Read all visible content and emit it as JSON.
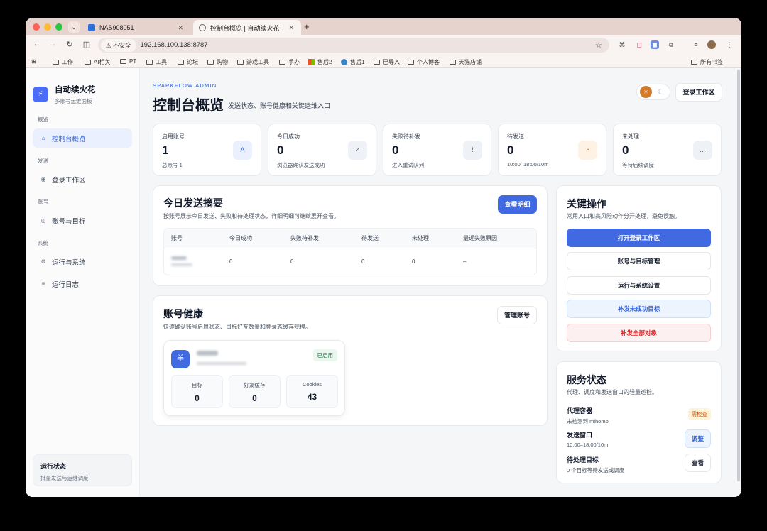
{
  "browser": {
    "tabs": [
      {
        "title": "NAS908051"
      },
      {
        "title": "控制台概览 | 自动续火花"
      }
    ],
    "insecure_label": "不安全",
    "url": "192.168.100.138:8787",
    "bookmarks": [
      "工作",
      "AI相关",
      "PT",
      "工具",
      "论坛",
      "购物",
      "游戏工具",
      "手办",
      "售后2",
      "售后1",
      "已导入",
      "个人博客",
      "天猫店铺"
    ],
    "all_bookmarks": "所有书签"
  },
  "sidebar": {
    "brand_title": "自动续火花",
    "brand_sub": "多账号运维面板",
    "sections": [
      {
        "label": "概览",
        "items": [
          {
            "label": "控制台概览",
            "icon": "home-icon"
          }
        ]
      },
      {
        "label": "发送",
        "items": [
          {
            "label": "登录工作区",
            "icon": "dot-icon"
          }
        ]
      },
      {
        "label": "账号",
        "items": [
          {
            "label": "账号与目标",
            "icon": "target-icon"
          }
        ]
      },
      {
        "label": "系统",
        "items": [
          {
            "label": "运行与系统",
            "icon": "gear-icon"
          },
          {
            "label": "运行日志",
            "icon": "list-icon"
          }
        ]
      }
    ],
    "status_title": "运行状态",
    "status_sub": "批量发送与运维调度"
  },
  "header": {
    "eyebrow": "SPARKFLOW ADMIN",
    "title": "控制台概览",
    "subtitle": "发送状态、账号健康和关键运维入口",
    "login_button": "登录工作区"
  },
  "stats": [
    {
      "label": "启用账号",
      "value": "1",
      "hint": "总账号 1",
      "icon": "A"
    },
    {
      "label": "今日成功",
      "value": "0",
      "hint": "浏览器确认发送成功",
      "icon": "✓"
    },
    {
      "label": "失败待补发",
      "value": "0",
      "hint": "进入重试队列",
      "icon": "!"
    },
    {
      "label": "待发送",
      "value": "0",
      "hint": "10:00–18:00/10m",
      "icon": "◔"
    },
    {
      "label": "未处理",
      "value": "0",
      "hint": "等待后续调度",
      "icon": "…"
    }
  ],
  "summary": {
    "title": "今日发送摘要",
    "subtitle": "按账号展示今日发送、失败和待处理状态，详细明细可继续展开查看。",
    "detail_button": "查看明细",
    "columns": [
      "账号",
      "今日成功",
      "失败待补发",
      "待发送",
      "未处理",
      "最近失败原因"
    ],
    "rows": [
      {
        "success": "0",
        "failed": "0",
        "pending": "0",
        "unhandled": "0",
        "reason": "–"
      }
    ]
  },
  "health": {
    "title": "账号健康",
    "subtitle": "快速确认账号启用状态、目标好友数量和登录态缓存规模。",
    "manage_button": "管理账号",
    "account": {
      "avatar": "羊",
      "status": "已启用",
      "metrics": [
        {
          "label": "目标",
          "value": "0"
        },
        {
          "label": "好友缓存",
          "value": "0"
        },
        {
          "label": "Cookies",
          "value": "43"
        }
      ]
    }
  },
  "actions": {
    "title": "关键操作",
    "subtitle": "常用入口和高风险动作分开处理，避免误触。",
    "buttons": [
      "打开登录工作区",
      "账号与目标管理",
      "运行与系统设置",
      "补发未成功目标",
      "补发全部对象"
    ]
  },
  "service": {
    "title": "服务状态",
    "subtitle": "代理、调度和发送窗口的轻量巡检。",
    "rows": [
      {
        "name": "代理容器",
        "desc": "未检测到 mihomo",
        "badge": "需检查"
      },
      {
        "name": "发送窗口",
        "desc": "10:00–18:00/10m",
        "button": "调整"
      },
      {
        "name": "待处理目标",
        "desc": "0 个目标等待发送或调度",
        "button": "查看"
      }
    ]
  }
}
